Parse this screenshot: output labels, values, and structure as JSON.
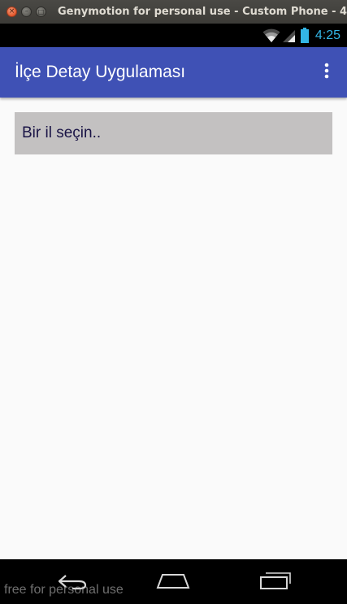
{
  "window": {
    "title": "Genymotion for personal use - Custom Phone - 4",
    "buttons": {
      "close": "×",
      "minimize": "–",
      "maximize": "□"
    }
  },
  "status_bar": {
    "time": "4:25",
    "icons": [
      "wifi-icon",
      "signal-icon",
      "battery-icon"
    ],
    "clock_color": "#33b5e5"
  },
  "app_bar": {
    "title": "İlçe Detay Uygulaması",
    "overflow_icon": "more-vert-icon",
    "color": "#3f51b5"
  },
  "main": {
    "spinner": {
      "selected_text": "Bir il seçin..",
      "background": "#c3c1c1"
    }
  },
  "nav_bar": {
    "icons": [
      "back-icon",
      "home-icon",
      "recent-apps-icon"
    ]
  },
  "watermark": {
    "text": "free for personal use"
  }
}
